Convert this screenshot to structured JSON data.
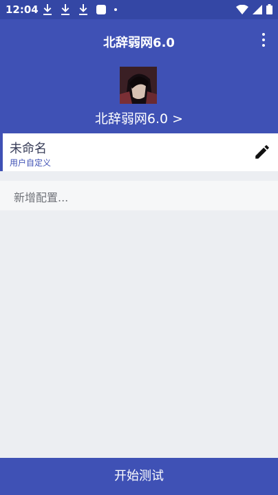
{
  "status_bar": {
    "time": "12:04"
  },
  "app_bar": {
    "title": "北辞弱网6.0"
  },
  "profile": {
    "name": "北辞弱网6.0 >"
  },
  "config_item": {
    "name": "未命名",
    "type": "用户自定义"
  },
  "add_config": {
    "placeholder": "新增配置..."
  },
  "bottom_button": {
    "label": "开始测试"
  },
  "colors": {
    "primary": "#3f51b5",
    "status_bar": "#3447a5",
    "background": "#eceef2"
  },
  "icons": [
    "download-icon",
    "download-icon",
    "download-icon",
    "notification-square-icon",
    "dot-icon",
    "wifi-icon",
    "signal-icon",
    "battery-icon",
    "more-vert-icon",
    "edit-pencil-icon"
  ]
}
